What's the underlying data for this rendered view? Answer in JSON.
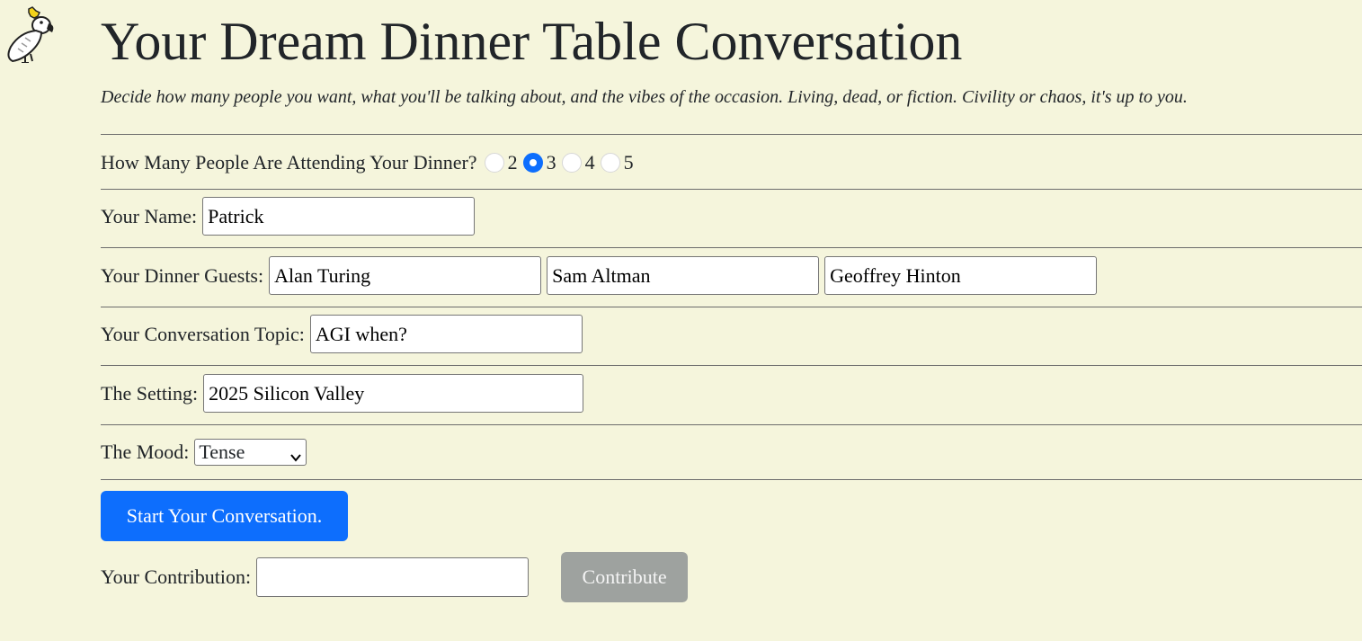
{
  "page": {
    "title": "Your Dream Dinner Table Conversation",
    "subtitle": "Decide how many people you want, what you'll be talking about, and the vibes of the occasion. Living, dead, or fiction. Civility or chaos, it's up to you."
  },
  "attendees": {
    "label": "How Many People Are Attending Your Dinner?",
    "options": [
      "2",
      "3",
      "4",
      "5"
    ],
    "selected": "3"
  },
  "name": {
    "label": "Your Name:",
    "value": "Patrick"
  },
  "guests": {
    "label": "Your Dinner Guests:",
    "values": [
      "Alan Turing",
      "Sam Altman",
      "Geoffrey Hinton"
    ]
  },
  "topic": {
    "label": "Your Conversation Topic:",
    "value": "AGI when?"
  },
  "setting": {
    "label": "The Setting:",
    "value": "2025 Silicon Valley"
  },
  "mood": {
    "label": "The Mood:",
    "selected": "Tense"
  },
  "start_button": {
    "label": "Start Your Conversation."
  },
  "contribution": {
    "label": "Your Contribution:",
    "value": "",
    "button_label": "Contribute"
  },
  "colors": {
    "background": "#f5f5dc",
    "primary": "#0d6efd",
    "disabled": "#9ea29f"
  },
  "icons": {
    "logo": "cockatoo-icon",
    "select_arrow": "chevron-down-icon"
  }
}
